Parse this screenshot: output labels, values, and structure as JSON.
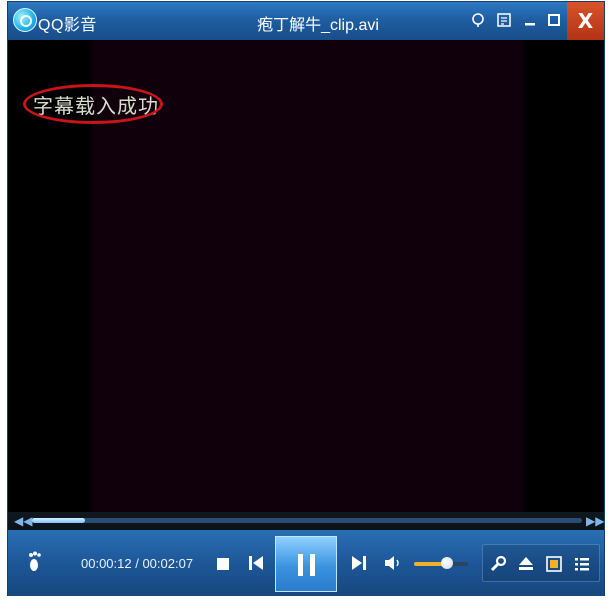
{
  "titlebar": {
    "app_name": "QQ影音",
    "file_name": "疱丁解牛_clip.avi",
    "icons": [
      "skin-icon",
      "list-mode-icon",
      "minimize-icon",
      "maximize-icon",
      "close-icon"
    ],
    "close_label": "X"
  },
  "video": {
    "osd_message": "字幕载入成功"
  },
  "seekbar": {
    "progress": 0.097
  },
  "controls": {
    "current_time": "00:00:12",
    "total_time": "00:02:07",
    "time_display": "00:00:12 / 00:02:07",
    "volume_level": 0.62,
    "icons": [
      "footprint-icon",
      "stop-icon",
      "previous-icon",
      "pause-icon",
      "next-icon",
      "volume-icon",
      "tools-icon",
      "eject-icon",
      "screen-mode-icon",
      "playlist-icon"
    ]
  },
  "colors": {
    "titlebar_blue": "#1f5ea2",
    "close_red": "#c9451f",
    "highlight_red": "#c8141a",
    "video_frame": "#0f000c",
    "volume_fill": "#f0b02c"
  }
}
